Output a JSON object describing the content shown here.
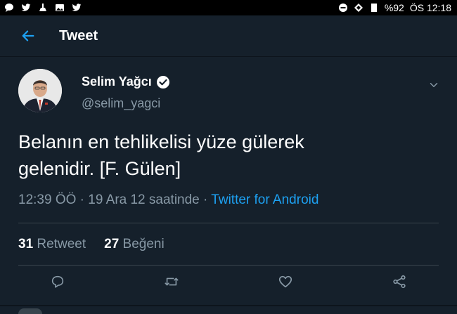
{
  "status_bar": {
    "battery": "%92",
    "time": "ÖS 12:18"
  },
  "header": {
    "title": "Tweet"
  },
  "tweet": {
    "display_name": "Selim Yağcı",
    "handle": "@selim_yagci",
    "text_line1": "Belanın en tehlikelisi yüze gülerek",
    "text_line2": "gelenidir. [F. Gülen]",
    "time": "12:39 ÖÖ",
    "sep1": "·",
    "date": "19 Ara 12 saatinde",
    "sep2": "·",
    "source": "Twitter for Android",
    "retweet_count": "31",
    "retweet_label": "Retweet",
    "like_count": "27",
    "like_label": "Beğeni"
  },
  "colors": {
    "background": "#15202b",
    "accent": "#1da1f2",
    "secondary_text": "#8899a6",
    "divider": "#38444d"
  },
  "icons": {
    "back": "arrow-left-icon",
    "verified": "verified-badge-icon",
    "caret": "chevron-down-icon",
    "reply": "reply-icon",
    "retweet": "retweet-icon",
    "like": "heart-icon",
    "share": "share-icon"
  }
}
